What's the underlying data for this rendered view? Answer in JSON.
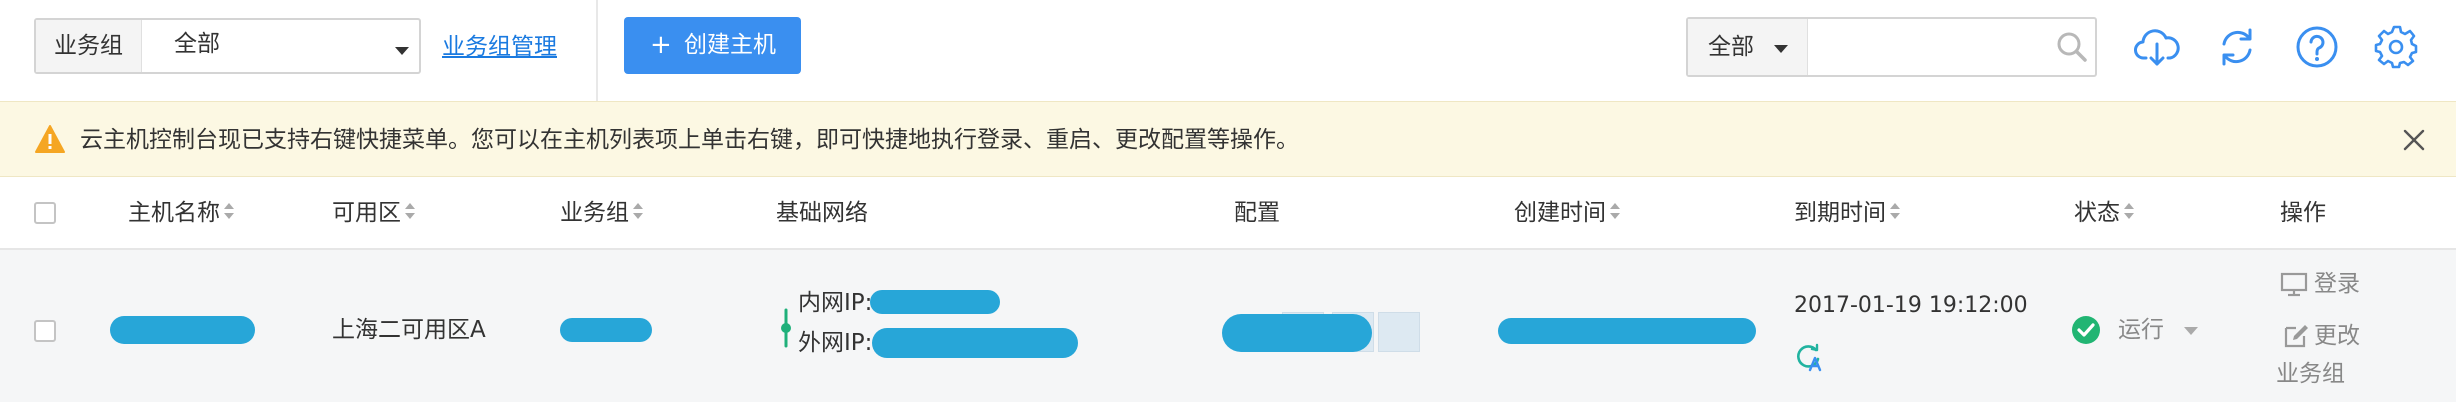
{
  "toolbar": {
    "group_label": "业务组",
    "group_value": "全部",
    "manage_link": "业务组管理",
    "create_button": "创建主机",
    "create_plus": "+",
    "search_scope": "全部",
    "search_value": ""
  },
  "notice": {
    "text": "云主机控制台现已支持右键快捷菜单。您可以在主机列表项上单击右键，即可快捷地执行登录、重启、更改配置等操作。"
  },
  "table": {
    "columns": [
      "主机名称",
      "可用区",
      "业务组",
      "基础网络",
      "配置",
      "创建时间",
      "到期时间",
      "状态",
      "操作"
    ],
    "rows": [
      {
        "zone": "上海二可用区A",
        "inner_ip_label": "内网IP:",
        "outer_ip_label": "外网IP:",
        "expire_time": "2017-01-19 19:12:00",
        "status": "运行",
        "ops": [
          "登录",
          "更改",
          "业务组"
        ]
      }
    ]
  },
  "colors": {
    "accent": "#3a8ff0",
    "link": "#1a7ae0",
    "notice_bg": "#fcf8e3",
    "warning": "#f5a623",
    "running": "#21b573",
    "redacted": "#27a6d8",
    "icon_blue": "#3a8ff0"
  },
  "icons": [
    "cloud-download-icon",
    "refresh-icon",
    "help-icon",
    "settings-gear-icon",
    "search-icon",
    "warning-icon",
    "close-icon",
    "monitor-icon",
    "edit-icon",
    "check-circle-icon",
    "network-icon",
    "auto-renew-icon"
  ]
}
